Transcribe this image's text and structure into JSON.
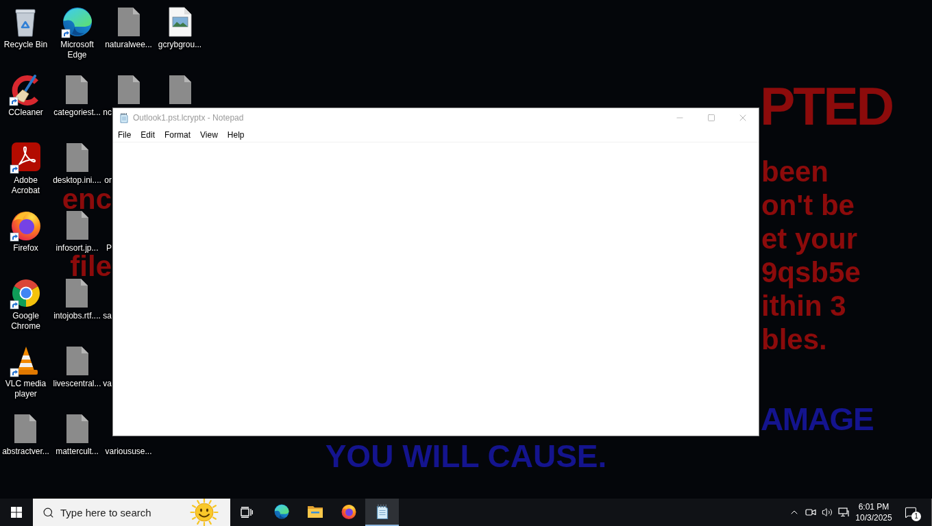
{
  "wallpaper": {
    "headline_right": "PTED",
    "body_left": [
      "enc",
      "file"
    ],
    "body_right": [
      "been",
      "on't be",
      "et your",
      "9qsb5e",
      "ithin 3",
      "bles."
    ],
    "warning_right": "AMAGE",
    "warning_last": "YOU WILL CAUSE."
  },
  "desktop_icons": [
    [
      {
        "label": "Recycle Bin",
        "kind": "system"
      },
      {
        "label": "CCleaner",
        "kind": "app"
      },
      {
        "label": "Adobe Acrobat",
        "kind": "app"
      },
      {
        "label": "Firefox",
        "kind": "app"
      },
      {
        "label": "Google Chrome",
        "kind": "app"
      },
      {
        "label": "VLC media player",
        "kind": "app"
      },
      {
        "label": "abstractver...",
        "kind": "file"
      }
    ],
    [
      {
        "label": "Microsoft Edge",
        "kind": "app"
      },
      {
        "label": "categoriest...",
        "kind": "file"
      },
      {
        "label": "desktop.ini....",
        "kind": "file"
      },
      {
        "label": "infosort.jp...",
        "kind": "file"
      },
      {
        "label": "intojobs.rtf....",
        "kind": "file"
      },
      {
        "label": "livescentral...",
        "kind": "file"
      },
      {
        "label": "mattercult...",
        "kind": "file"
      }
    ],
    [
      {
        "label": "naturalwee...",
        "kind": "file"
      },
      {
        "label": "nc",
        "kind": "cut"
      },
      {
        "label": "or",
        "kind": "hidden"
      },
      {
        "label": "P",
        "kind": "hidden"
      },
      {
        "label": "sa",
        "kind": "hidden"
      },
      {
        "label": "va",
        "kind": "hidden"
      },
      {
        "label": "varioususe...",
        "kind": "covered"
      }
    ],
    [
      {
        "label": "gcrybgrou...",
        "kind": "image"
      },
      {
        "kind": "file"
      }
    ]
  ],
  "notepad": {
    "title": "Outlook1.pst.lcryptx - Notepad",
    "focused": false,
    "menu": [
      "File",
      "Edit",
      "Format",
      "View",
      "Help"
    ]
  },
  "taskbar": {
    "search": {
      "placeholder": "Type here to search"
    },
    "pinned_apps": [
      {
        "selected": false
      },
      {
        "selected": false
      },
      {
        "selected": false
      },
      {
        "selected": true
      }
    ],
    "clock": {
      "time": "6:01 PM",
      "date": "10/3/2025"
    },
    "notifications": {
      "count": "1"
    }
  }
}
